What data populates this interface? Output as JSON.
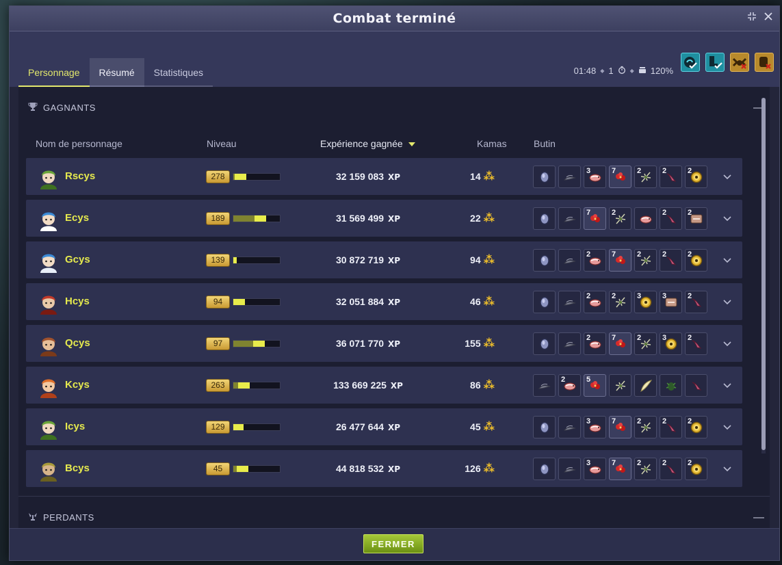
{
  "window": {
    "title": "Combat terminé"
  },
  "tabs": [
    {
      "label": "Personnage"
    },
    {
      "label": "Résumé"
    },
    {
      "label": "Statistiques"
    }
  ],
  "fight_info": {
    "duration": "01:48",
    "turns": "1",
    "bonus": "120%"
  },
  "challenges": [
    {
      "icon": "challenge-success-icon",
      "color": "#1f8fa0"
    },
    {
      "icon": "challenge-success-icon",
      "color": "#1f8fa0"
    },
    {
      "icon": "challenge-failed-icon",
      "color": "#b88a2c"
    },
    {
      "icon": "challenge-failed-icon",
      "color": "#b88a2c"
    }
  ],
  "winners": {
    "heading": "GAGNANTS",
    "columns": {
      "name": "Nom de personnage",
      "level": "Niveau",
      "xp": "Expérience gagnée",
      "kamas": "Kamas",
      "loot": "Butin"
    },
    "rows": [
      {
        "name": "Rscys",
        "level": "278",
        "level_progress": 0.28,
        "xp": "32 159 083",
        "kamas": "14",
        "loot": [
          {
            "q": "",
            "t": "stone"
          },
          {
            "q": "",
            "t": "feather"
          },
          {
            "q": "3",
            "t": "fish"
          },
          {
            "q": "7",
            "t": "flower"
          },
          {
            "q": "2",
            "t": "plant"
          },
          {
            "q": "2",
            "t": "claw"
          },
          {
            "q": "2",
            "t": "coin"
          }
        ]
      },
      {
        "name": "Ecys",
        "level": "189",
        "level_progress": 0.7,
        "xp": "31 569 499",
        "kamas": "22",
        "loot": [
          {
            "q": "",
            "t": "stone"
          },
          {
            "q": "",
            "t": "feather"
          },
          {
            "q": "7",
            "t": "flower"
          },
          {
            "q": "2",
            "t": "plant"
          },
          {
            "q": "",
            "t": "fish"
          },
          {
            "q": "2",
            "t": "claw"
          },
          {
            "q": "2",
            "t": "bone"
          }
        ]
      },
      {
        "name": "Gcys",
        "level": "139",
        "level_progress": 0.08,
        "xp": "30 872 719",
        "kamas": "94",
        "loot": [
          {
            "q": "",
            "t": "stone"
          },
          {
            "q": "",
            "t": "feather"
          },
          {
            "q": "2",
            "t": "fish"
          },
          {
            "q": "7",
            "t": "flower"
          },
          {
            "q": "2",
            "t": "plant"
          },
          {
            "q": "2",
            "t": "claw"
          },
          {
            "q": "2",
            "t": "coin"
          }
        ]
      },
      {
        "name": "Hcys",
        "level": "94",
        "level_progress": 0.25,
        "xp": "32 051 884",
        "kamas": "46",
        "loot": [
          {
            "q": "",
            "t": "stone"
          },
          {
            "q": "",
            "t": "feather"
          },
          {
            "q": "2",
            "t": "fish"
          },
          {
            "q": "2",
            "t": "plant"
          },
          {
            "q": "3",
            "t": "coin"
          },
          {
            "q": "3",
            "t": "bone"
          },
          {
            "q": "2",
            "t": "claw"
          }
        ]
      },
      {
        "name": "Qcys",
        "level": "97",
        "level_progress": 0.68,
        "xp": "36 071 770",
        "kamas": "155",
        "loot": [
          {
            "q": "",
            "t": "stone"
          },
          {
            "q": "",
            "t": "feather"
          },
          {
            "q": "2",
            "t": "fish"
          },
          {
            "q": "7",
            "t": "flower"
          },
          {
            "q": "2",
            "t": "plant"
          },
          {
            "q": "3",
            "t": "coin"
          },
          {
            "q": "2",
            "t": "claw"
          }
        ]
      },
      {
        "name": "Kcys",
        "level": "263",
        "level_progress": 0.35,
        "xp": "133 669 225",
        "kamas": "86",
        "loot": [
          {
            "q": "",
            "t": "feather"
          },
          {
            "q": "2",
            "t": "fish"
          },
          {
            "q": "5",
            "t": "flower"
          },
          {
            "q": "",
            "t": "plant"
          },
          {
            "q": "",
            "t": "wing"
          },
          {
            "q": "",
            "t": "bug"
          },
          {
            "q": "",
            "t": "claw"
          }
        ]
      },
      {
        "name": "Icys",
        "level": "129",
        "level_progress": 0.22,
        "xp": "26 477 644",
        "kamas": "45",
        "loot": [
          {
            "q": "",
            "t": "stone"
          },
          {
            "q": "",
            "t": "feather"
          },
          {
            "q": "3",
            "t": "fish"
          },
          {
            "q": "7",
            "t": "flower"
          },
          {
            "q": "2",
            "t": "plant"
          },
          {
            "q": "2",
            "t": "claw"
          },
          {
            "q": "2",
            "t": "coin"
          }
        ]
      },
      {
        "name": "Bcys",
        "level": "45",
        "level_progress": 0.33,
        "xp": "44 818 532",
        "kamas": "126",
        "loot": [
          {
            "q": "",
            "t": "stone"
          },
          {
            "q": "",
            "t": "feather"
          },
          {
            "q": "3",
            "t": "fish"
          },
          {
            "q": "7",
            "t": "flower"
          },
          {
            "q": "2",
            "t": "plant"
          },
          {
            "q": "2",
            "t": "claw"
          },
          {
            "q": "2",
            "t": "coin"
          }
        ]
      }
    ]
  },
  "losers": {
    "heading": "PERDANTS"
  },
  "footer": {
    "close_label": "FERMER"
  },
  "units": {
    "xp": "XP"
  }
}
